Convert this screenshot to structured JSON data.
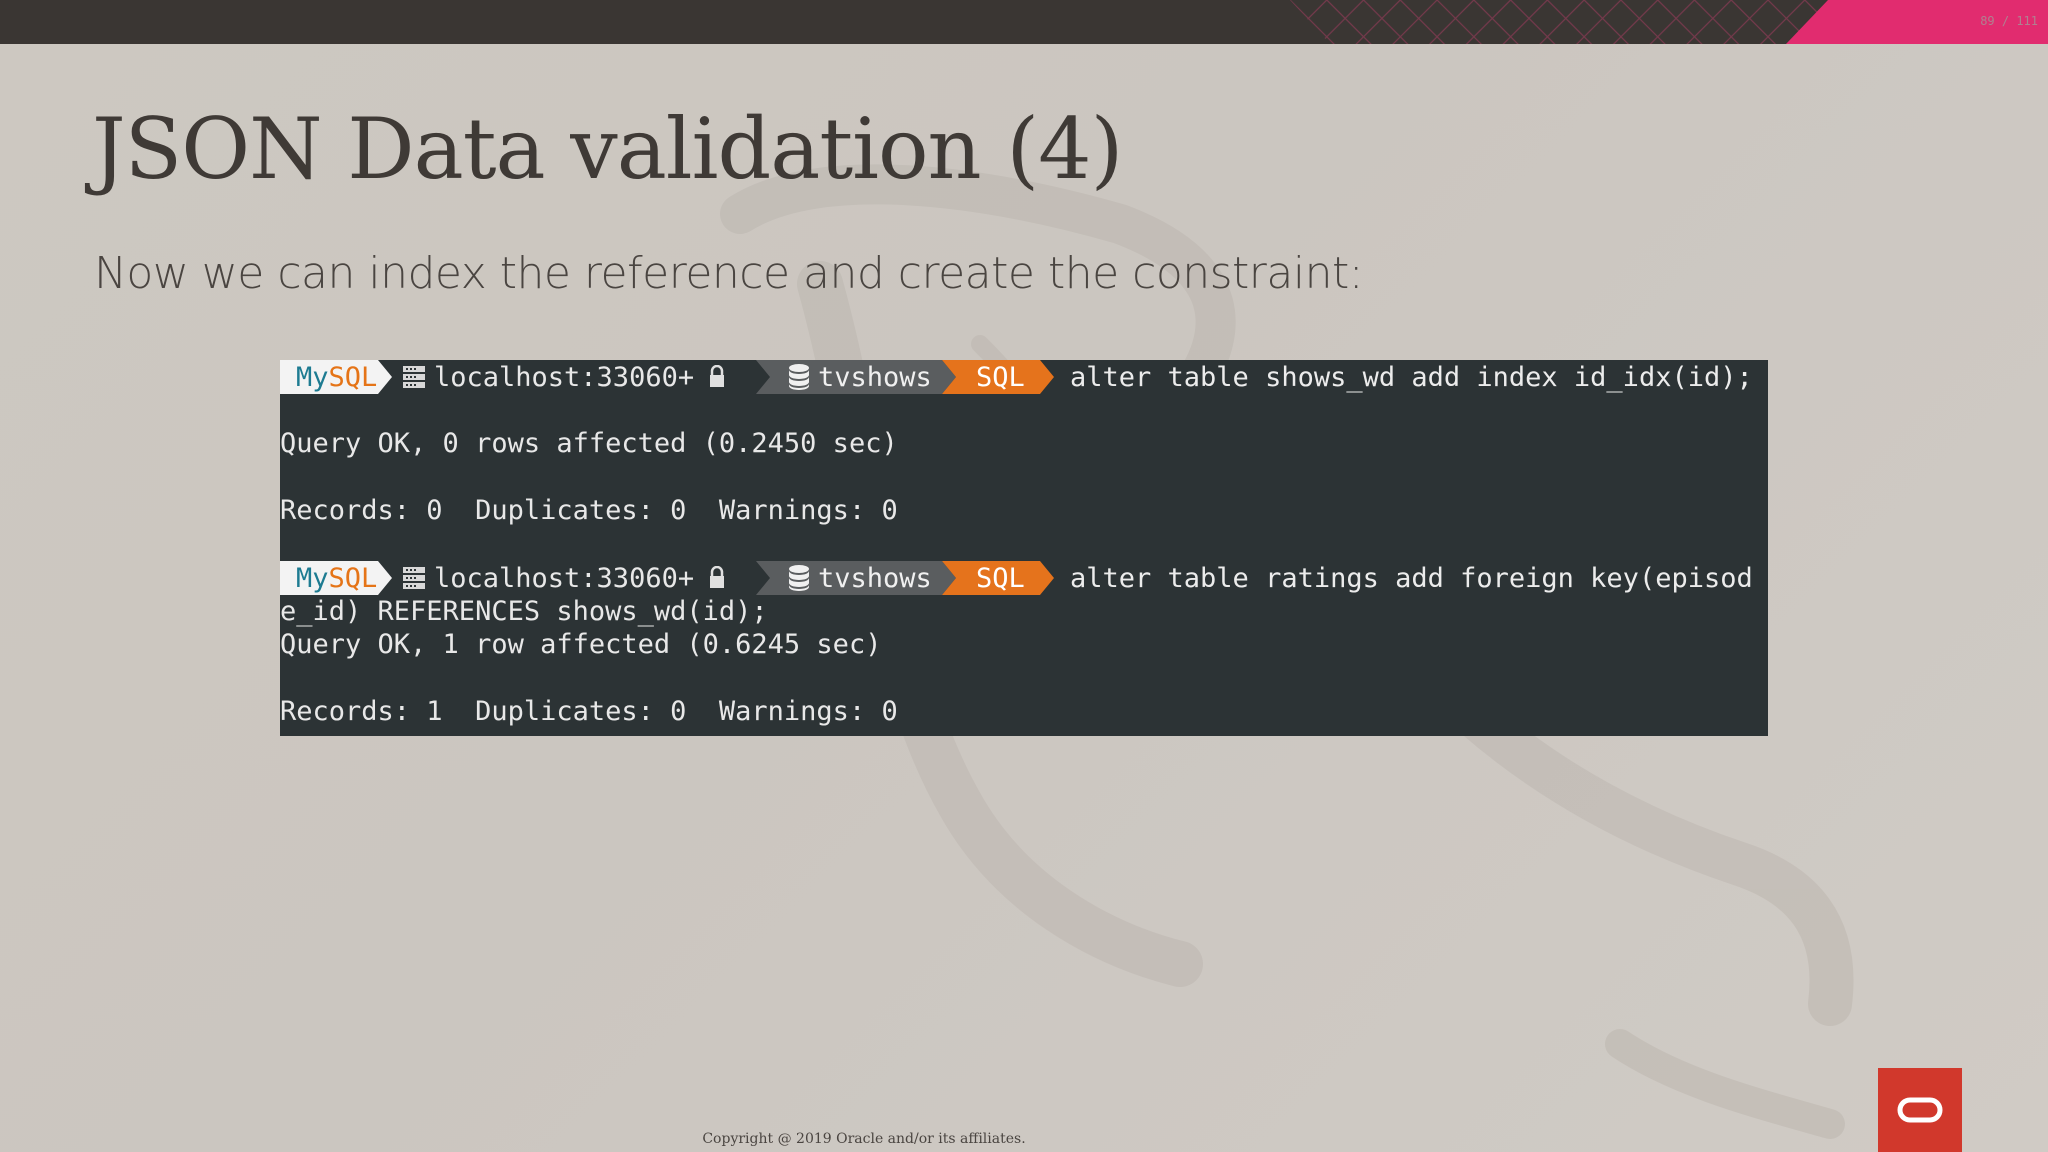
{
  "slide": {
    "page_indicator": "89 / 111",
    "title": "JSON Data validation (4)",
    "subtitle": "Now we can index the reference and create the constraint:",
    "footer": "Copyright @ 2019 Oracle and/or its affiliates."
  },
  "terminal": {
    "prompts": [
      {
        "mysql_my": "My",
        "mysql_sql": "SQL",
        "host": "localhost:33060+",
        "schema": "tvshows",
        "mode": "SQL",
        "command": "alter table shows_wd add index id_idx(id);"
      },
      {
        "mysql_my": "My",
        "mysql_sql": "SQL",
        "host": "localhost:33060+",
        "schema": "tvshows",
        "mode": "SQL",
        "command": "alter table ratings add foreign key(episod"
      }
    ],
    "output1": {
      "line1": "Query OK, 0 rows affected (0.2450 sec)",
      "line2": "Records: 0  Duplicates: 0  Warnings: 0"
    },
    "output2": {
      "wrap": "e_id) REFERENCES shows_wd(id);",
      "line1": "Query OK, 1 row affected (0.6245 sec)",
      "line2": "Records: 1  Duplicates: 0  Warnings: 0"
    }
  },
  "icons": {
    "server": "server-icon",
    "lock": "lock-icon",
    "database": "database-icon",
    "logo": "oracle-logo-icon"
  },
  "colors": {
    "top_bar": "#3a3633",
    "accent_pink": "#e12c6f",
    "terminal_bg": "#2c3335",
    "mysql_blue": "#1d7b91",
    "mysql_orange": "#e57417",
    "logo_red": "#d1382c"
  }
}
